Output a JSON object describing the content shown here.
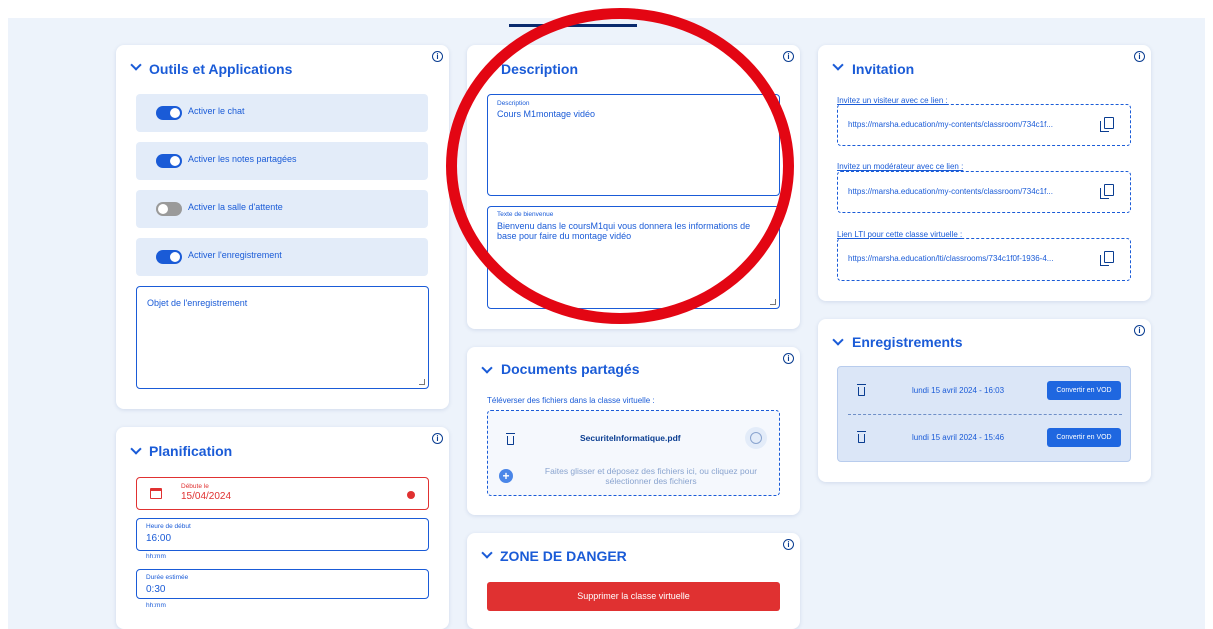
{
  "outils": {
    "title": "Outils et Applications",
    "info": "i",
    "toggles": [
      {
        "label": "Activer le chat",
        "on": true
      },
      {
        "label": "Activer les notes partagées",
        "on": true
      },
      {
        "label": "Activer la salle d'attente",
        "on": false
      },
      {
        "label": "Activer l'enregistrement",
        "on": true
      }
    ],
    "recording_placeholder": "Objet de l'enregistrement"
  },
  "planification": {
    "title": "Planification",
    "info": "i",
    "start_label": "Débute le",
    "start_value": "15/04/2024",
    "time_label": "Heure de début",
    "time_value": "16:00",
    "time_hint": "hh:mm",
    "duration_label": "Durée estimée",
    "duration_value": "0:30",
    "duration_hint": "hh:mm"
  },
  "description": {
    "title": "Description",
    "info": "i",
    "desc_label": "Description",
    "desc_value": "Cours M1montage vidéo",
    "welcome_label": "Texte de bienvenue",
    "welcome_value": "Bienvenu dans le coursM1qui vous donnera les informations de base pour faire du montage vidéo"
  },
  "documents": {
    "title": "Documents partagés",
    "info": "i",
    "upload_label": "Téléverser des fichiers dans la classe virtuelle :",
    "file_name": "SecuriteInformatique.pdf",
    "drop_hint": "Faites glisser et déposez des fichiers ici, ou cliquez pour sélectionner des fichiers"
  },
  "danger": {
    "title": "ZONE DE DANGER",
    "info": "i",
    "delete_button": "Supprimer la classe virtuelle"
  },
  "invitation": {
    "title": "Invitation",
    "info": "i",
    "links": [
      {
        "caption": "Invitez un visiteur avec ce lien :",
        "url": "https://marsha.education/my-contents/classroom/734c1f..."
      },
      {
        "caption": "Invitez un modérateur avec ce lien :",
        "url": "https://marsha.education/my-contents/classroom/734c1f..."
      },
      {
        "caption": "Lien LTI pour cette classe virtuelle :",
        "url": "https://marsha.education/lti/classrooms/734c1f0f-1936-4..."
      }
    ]
  },
  "enregistrements": {
    "title": "Enregistrements",
    "info": "i",
    "items": [
      {
        "date": "lundi 15 avril 2024 - 16:03",
        "button": "Convertir en VOD"
      },
      {
        "date": "lundi 15 avril 2024 - 15:46",
        "button": "Convertir en VOD"
      }
    ]
  },
  "colors": {
    "accent": "#1a5bd7",
    "background": "#edf3fb",
    "danger": "#e03131",
    "annotation": "#e30613"
  }
}
